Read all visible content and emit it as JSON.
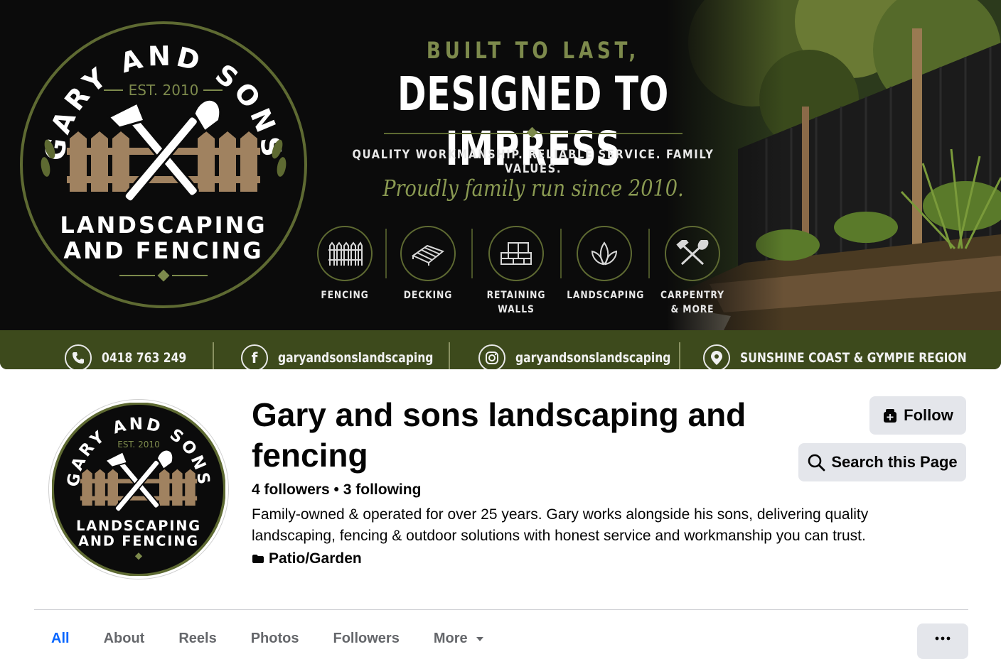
{
  "cover": {
    "logo": {
      "top_text": "GARY AND SONS",
      "est": "EST. 2010",
      "line1": "LANDSCAPING",
      "line2": "AND FENCING"
    },
    "headline_top": "BUILT TO LAST,",
    "headline_main": "DESIGNED TO IMPRESS",
    "tagline": "QUALITY WORKMANSHIP. RELIABLE SERVICE. FAMILY VALUES.",
    "script_line": "Proudly family run since 2010.",
    "services": [
      {
        "label": "FENCING",
        "icon": "fence-icon"
      },
      {
        "label": "DECKING",
        "icon": "decking-icon"
      },
      {
        "label": "RETAINING\nWALLS",
        "icon": "brick-wall-icon"
      },
      {
        "label": "LANDSCAPING",
        "icon": "leaf-icon"
      },
      {
        "label": "CARPENTRY\n& MORE",
        "icon": "tools-icon"
      }
    ],
    "contacts": {
      "phone": "0418 763 249",
      "facebook": "garyandsonslandscaping",
      "instagram": "garyandsonslandscaping",
      "location": "SUNSHINE COAST & GYMPIE REGION"
    },
    "colors": {
      "olive": "#5e6a32",
      "bar": "#3d4a1c",
      "fence_wood": "#a08260"
    }
  },
  "profile": {
    "name": "Gary and sons landscaping and fencing",
    "followers": "4 followers",
    "separator": "•",
    "following": "3 following",
    "bio": "Family-owned & operated for over 25 years. Gary works alongside his sons, delivering quality landscaping, fencing & outdoor solutions with honest service and workmanship you can trust.",
    "category": "Patio/Garden"
  },
  "actions": {
    "follow": "Follow",
    "search": "Search this Page"
  },
  "tabs": [
    {
      "label": "All",
      "active": true
    },
    {
      "label": "About",
      "active": false
    },
    {
      "label": "Reels",
      "active": false
    },
    {
      "label": "Photos",
      "active": false
    },
    {
      "label": "Followers",
      "active": false
    },
    {
      "label": "More",
      "active": false
    }
  ],
  "accent_color": "#0866ff"
}
